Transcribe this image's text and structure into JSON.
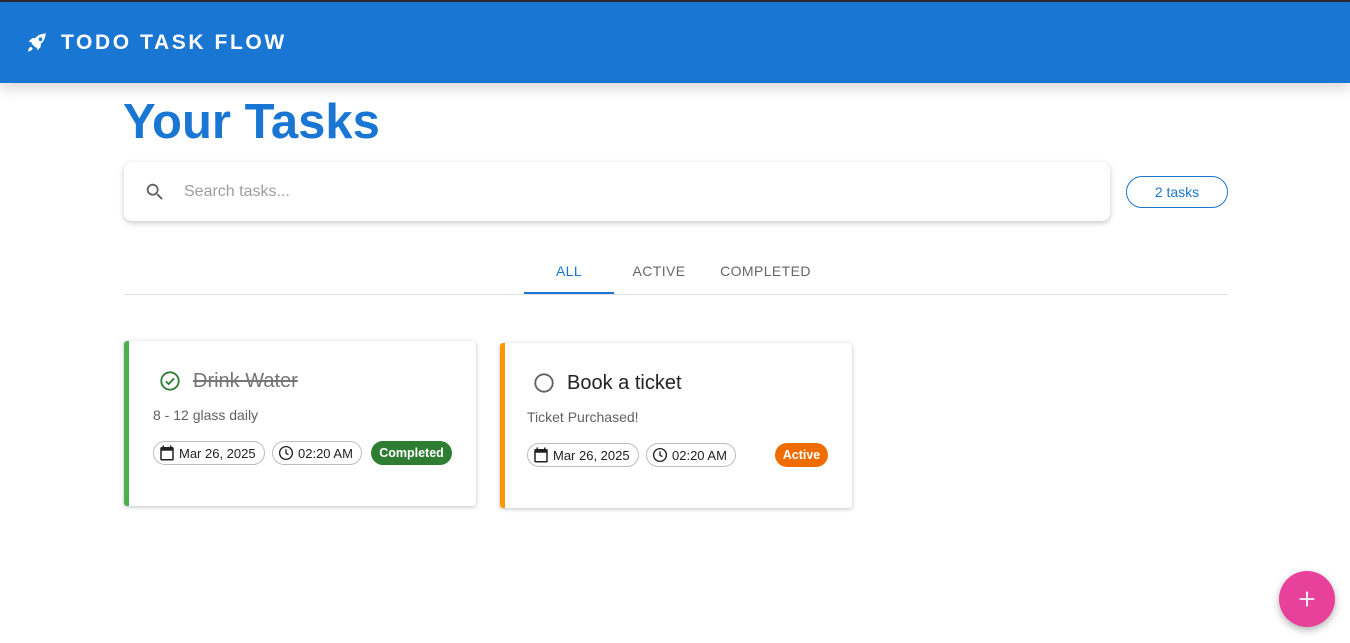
{
  "appbar": {
    "title": "TODO TASK FLOW",
    "logo_icon": "rocket-icon",
    "color": "#1976d2"
  },
  "page": {
    "title": "Your Tasks"
  },
  "search": {
    "placeholder": "Search tasks...",
    "value": "",
    "icon": "search-icon"
  },
  "task_count": "2 tasks",
  "tabs": [
    {
      "label": "ALL",
      "active": true
    },
    {
      "label": "ACTIVE",
      "active": false
    },
    {
      "label": "COMPLETED",
      "active": false
    }
  ],
  "tasks": [
    {
      "title": "Drink Water",
      "description": "8 - 12 glass daily",
      "date": "Mar 26, 2025",
      "time": "02:20 AM",
      "status": "Completed",
      "completed": true,
      "accent_color": "#4caf50",
      "badge_color": "#2e7d32"
    },
    {
      "title": "Book a ticket",
      "description": "Ticket Purchased!",
      "date": "Mar 26, 2025",
      "time": "02:20 AM",
      "status": "Active",
      "completed": false,
      "accent_color": "#ff9800",
      "badge_color": "#ef6c00"
    }
  ],
  "fab": {
    "icon": "plus-icon",
    "color": "#e7419b"
  }
}
